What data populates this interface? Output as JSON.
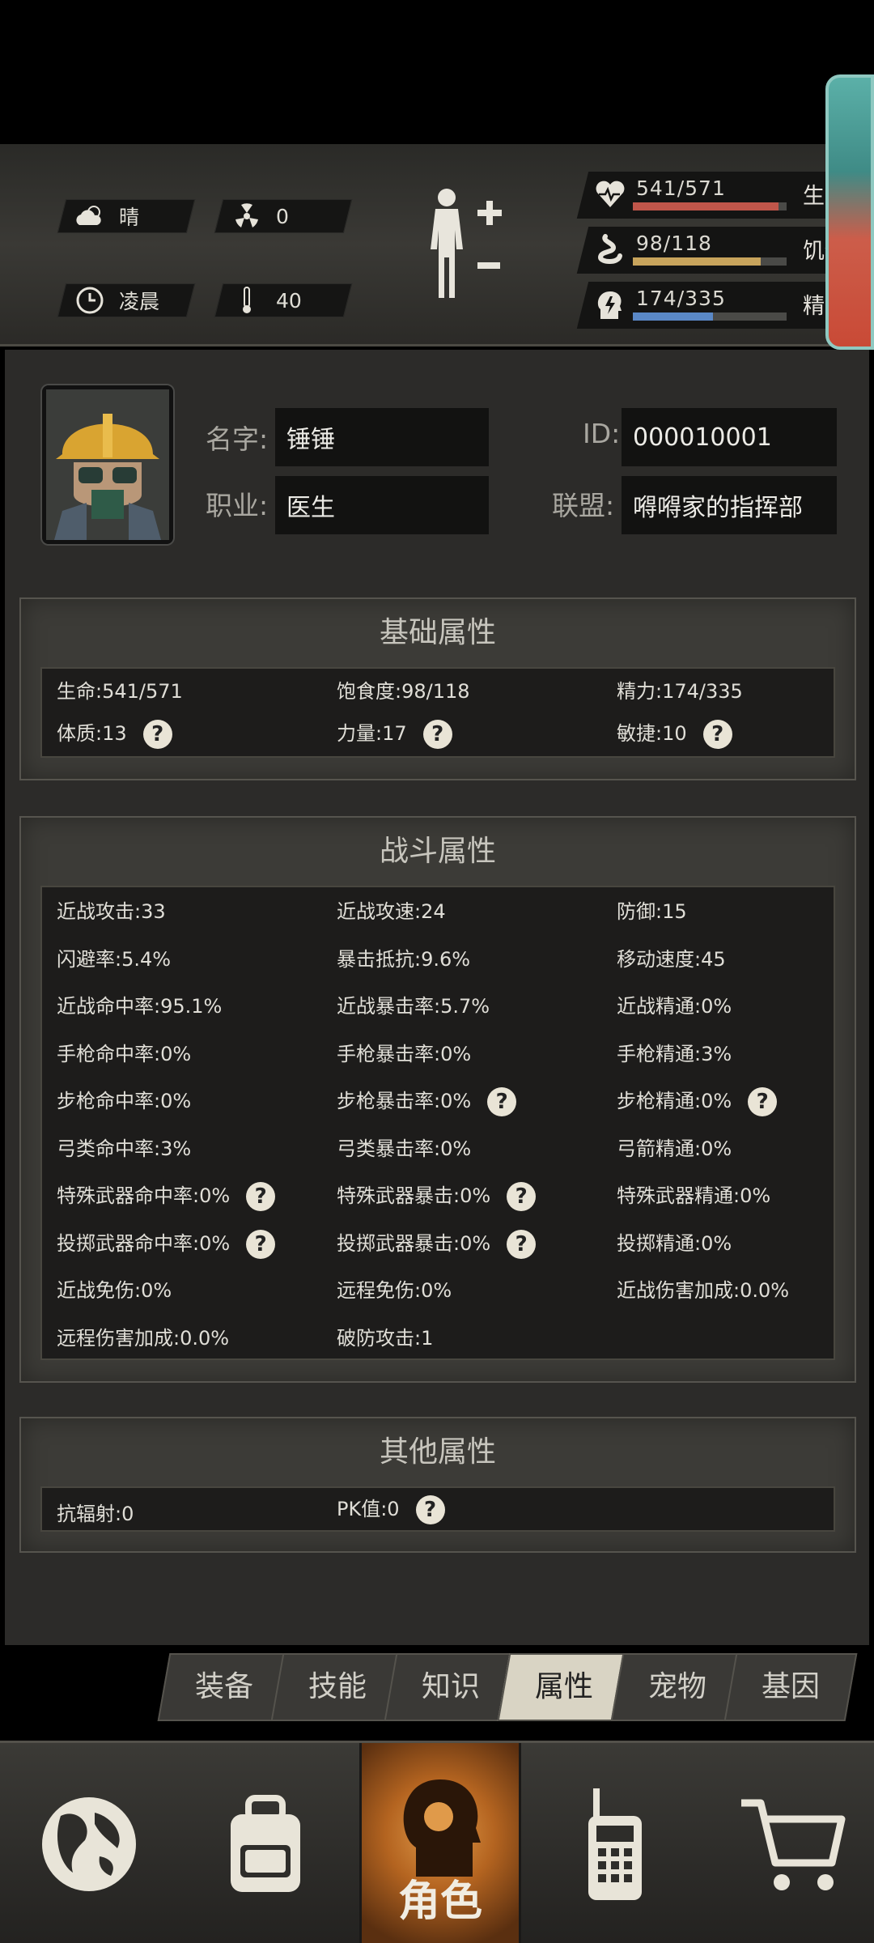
{
  "status": {
    "weather": "晴",
    "radiation": "0",
    "time_of_day": "凌晨",
    "temperature": "40"
  },
  "vitals": [
    {
      "label": "生命",
      "value": "541/571",
      "fill": 0.947,
      "color": "#c0564a"
    },
    {
      "label": "饥饿",
      "value": "98/118",
      "fill": 0.83,
      "color": "#c8a45c"
    },
    {
      "label": "精力",
      "value": "174/335",
      "fill": 0.52,
      "color": "#5a88c6"
    }
  ],
  "profile": {
    "name_label": "名字:",
    "name": "锤锤",
    "id_label": "ID:",
    "id": "000010001",
    "job_label": "职业:",
    "job": "医生",
    "alliance_label": "联盟:",
    "alliance": "嘚嘚家的指挥部"
  },
  "basic": {
    "title": "基础属性",
    "rows": [
      [
        "生命:541/571",
        "饱食度:98/118",
        "精力:174/335"
      ],
      [
        "体质:13",
        "力量:17",
        "敏捷:10"
      ]
    ]
  },
  "combat": {
    "title": "战斗属性",
    "rows": [
      [
        "近战攻击:33",
        "近战攻速:24",
        "防御:15"
      ],
      [
        "闪避率:5.4%",
        "暴击抵抗:9.6%",
        "移动速度:45"
      ],
      [
        "近战命中率:95.1%",
        "近战暴击率:5.7%",
        "近战精通:0%"
      ],
      [
        "手枪命中率:0%",
        "手枪暴击率:0%",
        "手枪精通:3%"
      ],
      [
        "步枪命中率:0%",
        "步枪暴击率:0%",
        "步枪精通:0%"
      ],
      [
        "弓类命中率:3%",
        "弓类暴击率:0%",
        "弓箭精通:0%"
      ],
      [
        "特殊武器命中率:0%",
        "特殊武器暴击:0%",
        "特殊武器精通:0%"
      ],
      [
        "投掷武器命中率:0%",
        "投掷武器暴击:0%",
        "投掷精通:0%"
      ],
      [
        "近战免伤:0%",
        "远程免伤:0%",
        "近战伤害加成:0.0%"
      ],
      [
        "远程伤害加成:0.0%",
        "破防攻击:1",
        ""
      ]
    ]
  },
  "other": {
    "title": "其他属性",
    "rows": [
      [
        "抗辐射:0",
        "PK值:0",
        ""
      ]
    ]
  },
  "help_glyph": "?",
  "tabs": [
    "装备",
    "技能",
    "知识",
    "属性",
    "宠物",
    "基因"
  ],
  "active_tab": "属性",
  "nav": {
    "role_label": "角色",
    "icons": [
      "globe-icon",
      "backpack-icon",
      "head-icon",
      "radio-icon",
      "cart-icon"
    ]
  }
}
